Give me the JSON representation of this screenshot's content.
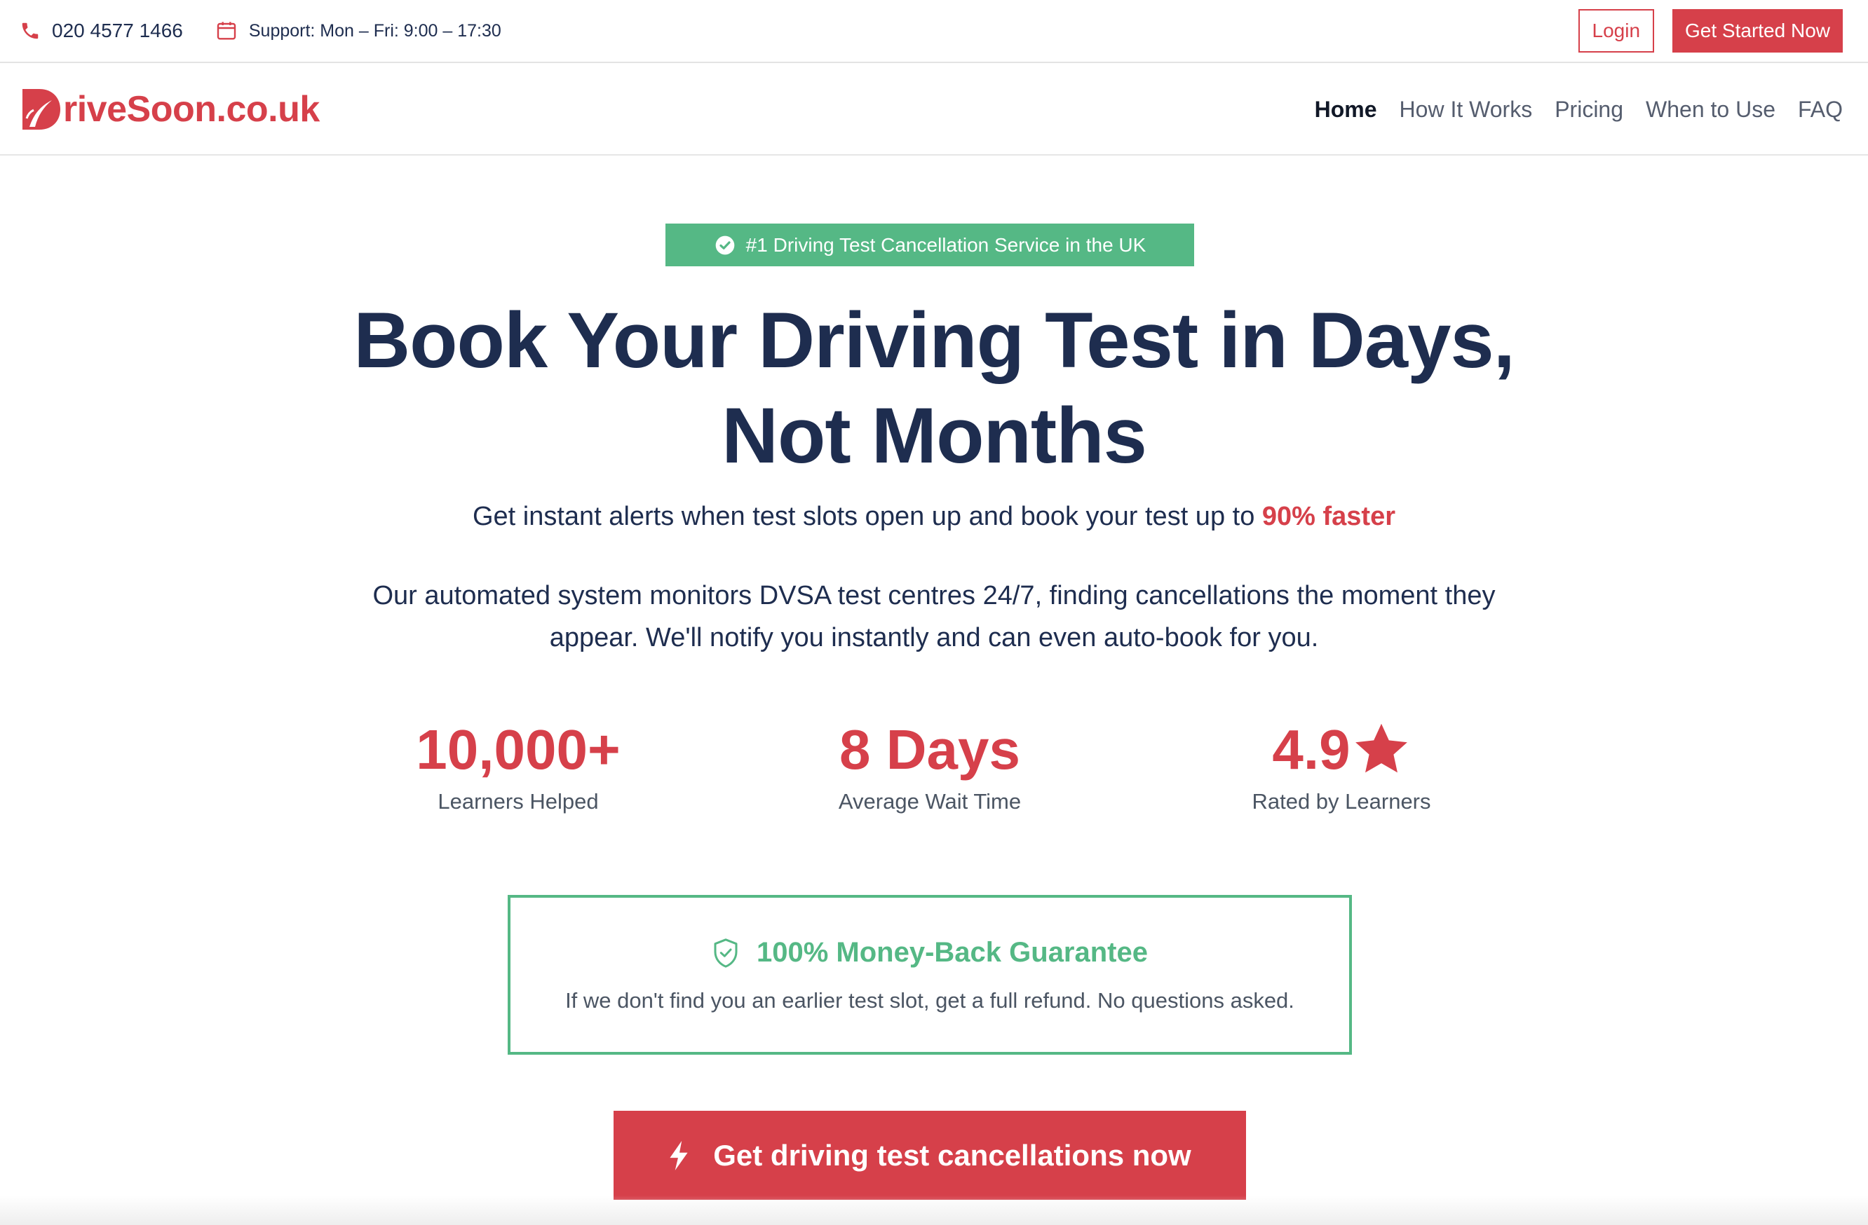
{
  "topbar": {
    "phone": "020 4577 1466",
    "support": "Support: Mon – Fri: 9:00 – 17:30",
    "login_label": "Login",
    "get_started_label": "Get Started Now"
  },
  "brand": {
    "logo_text": "riveSoon.co.uk",
    "accent_color": "#d6404a",
    "green_color": "#55b885",
    "navy_color": "#1e2d4f"
  },
  "nav": {
    "items": [
      {
        "label": "Home",
        "active": true
      },
      {
        "label": "How It Works"
      },
      {
        "label": "Pricing"
      },
      {
        "label": "When to Use"
      },
      {
        "label": "FAQ"
      }
    ]
  },
  "hero": {
    "badge": "#1 Driving Test Cancellation Service in the UK",
    "title_line1": "Book Your Driving Test in Days,",
    "title_line2": "Not Months",
    "subtitle_prefix": "Get instant alerts when test slots open up and book your test up to ",
    "subtitle_highlight": "90% faster",
    "description": "Our automated system monitors DVSA test centres 24/7, finding cancellations the moment they appear. We'll notify you instantly and can even auto-book for you."
  },
  "stats": [
    {
      "value": "10,000+",
      "label": "Learners Helped"
    },
    {
      "value": "8 Days",
      "label": "Average Wait Time"
    },
    {
      "value": "4.9",
      "label": "Rated by Learners",
      "icon": "star-icon"
    }
  ],
  "guarantee": {
    "title": "100% Money-Back Guarantee",
    "text": "If we don't find you an earlier test slot, get a full refund. No questions asked."
  },
  "cta": {
    "label": "Get driving test cancellations now"
  }
}
